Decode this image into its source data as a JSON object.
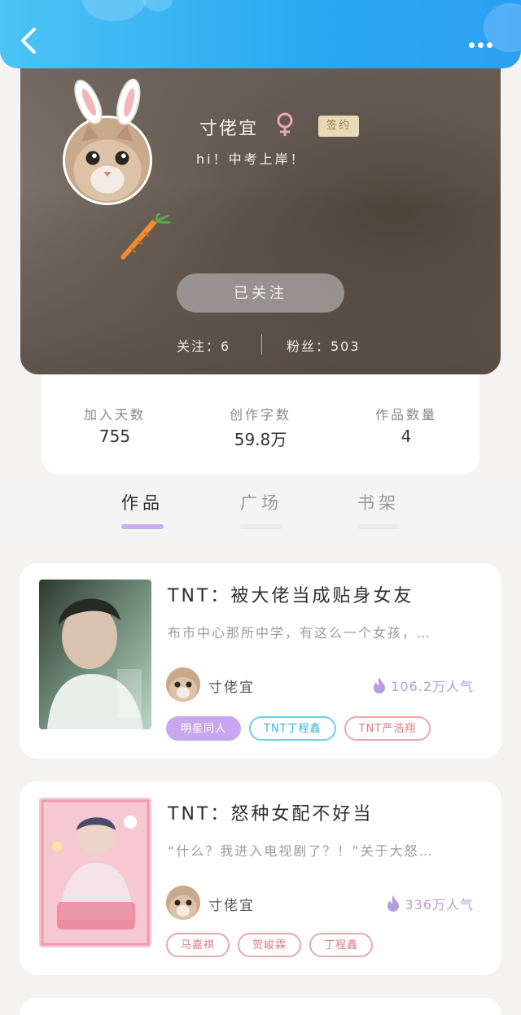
{
  "header": {
    "back_icon": "chevron-left-icon",
    "more_icon": "more-dots-icon"
  },
  "profile": {
    "name": "寸佬宜",
    "gender_icon": "female-icon",
    "sign_badge": "签约",
    "bio": "hi！中考上岸！",
    "follow_button": "已关注",
    "following": "关注：6",
    "fans": "粉丝：503"
  },
  "stats": [
    {
      "label": "加入天数",
      "value": "755"
    },
    {
      "label": "创作字数",
      "value": "59.8万"
    },
    {
      "label": "作品数量",
      "value": "4"
    }
  ],
  "tabs": [
    {
      "label": "作品",
      "active": true
    },
    {
      "label": "广场",
      "active": false
    },
    {
      "label": "书架",
      "active": false
    }
  ],
  "books": [
    {
      "title": "TNT：被大佬当成贴身女友",
      "desc": "布市中心那所中学，有这么一个女孩，…",
      "author": "寸佬宜",
      "popularity": "106.2万人气",
      "tags": [
        "明星同人",
        "TNT丁程鑫",
        "TNT严浩翔"
      ]
    },
    {
      "title": "TNT：怒种女配不好当",
      "desc": "“什么？我进入电视剧了？！”关于大怒…",
      "author": "寸佬宜",
      "popularity": "336万人气",
      "tags": [
        "马嘉祺",
        "贺峻霖",
        "丁程鑫"
      ]
    }
  ],
  "colors": {
    "header": "#2aa8f2",
    "accent": "#c7a8ec",
    "popularity": "#b79be0"
  }
}
